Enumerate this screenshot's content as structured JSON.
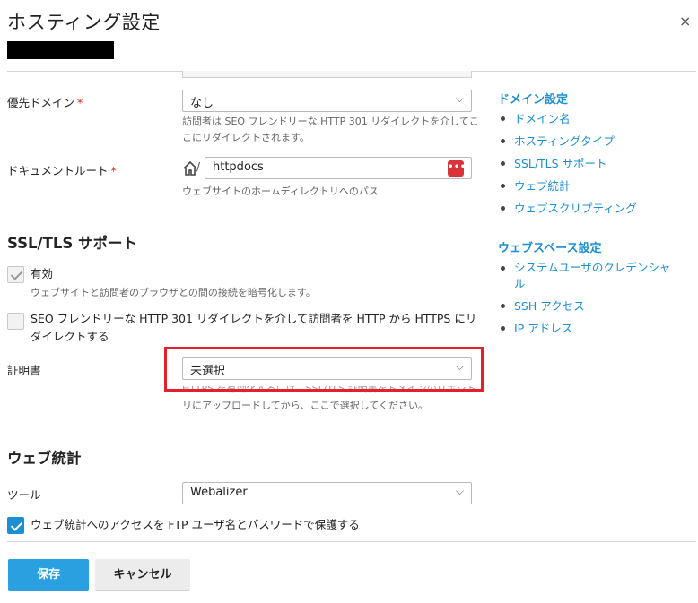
{
  "dialog": {
    "title": "ホスティング設定",
    "close": "×"
  },
  "fields": {
    "preferred_domain": {
      "label": "優先ドメイン",
      "required_mark": "*",
      "value": "なし",
      "hint_line1": "訪問者は SEO フレンドリーな HTTP 301 リダイレクトを介してこ",
      "hint_line2": "こにリダイレクトされます。"
    },
    "document_root": {
      "label": "ドキュメントルート",
      "required_mark": "*",
      "prefix": "/",
      "value": "httpdocs",
      "browse_icon": "•••",
      "hint": "ウェブサイトのホームディレクトリへのパス"
    }
  },
  "ssl": {
    "title": "SSL/TLS サポート",
    "enabled_label": "有効",
    "enabled_checked": true,
    "enabled_hint": "ウェブサイトと訪問者のブラウザとの間の接続を暗号化します。",
    "redirect_label_line1": "SEO フレンドリーな HTTP 301 リダイレクトを介して訪問者を HTTP から HTTPS にリ",
    "redirect_label_line2": "ダイレクトする",
    "redirect_checked": false,
    "certificate_label": "証明書",
    "certificate_value": "未選択",
    "certificate_hint_line1": "HTTPS を有効化するには、SSL/TLS 証明書をドメインのリポジト",
    "certificate_hint_line2": "リにアップロードしてから、ここで選択してください。"
  },
  "stats": {
    "title": "ウェブ統計",
    "tool_label": "ツール",
    "tool_value": "Webalizer",
    "protect_label": "ウェブ統計へのアクセスを FTP ユーザ名とパスワードで保護する",
    "protect_checked": true
  },
  "sidebar": {
    "domain_heading": "ドメイン設定",
    "domain_items": [
      "ドメイン名",
      "ホスティングタイプ",
      "SSL/TLS サポート",
      "ウェブ統計",
      "ウェブスクリプティング"
    ],
    "webspace_heading": "ウェブスペース設定",
    "webspace_items": [
      "システムユーザのクレデンシャル",
      "SSH アクセス",
      "IP アドレス"
    ]
  },
  "buttons": {
    "save": "保存",
    "cancel": "キャンセル"
  },
  "colors": {
    "accent": "#1b8fd1",
    "save_button": "#2aa0e0",
    "required": "#e02020",
    "highlight": "#e3202b"
  }
}
